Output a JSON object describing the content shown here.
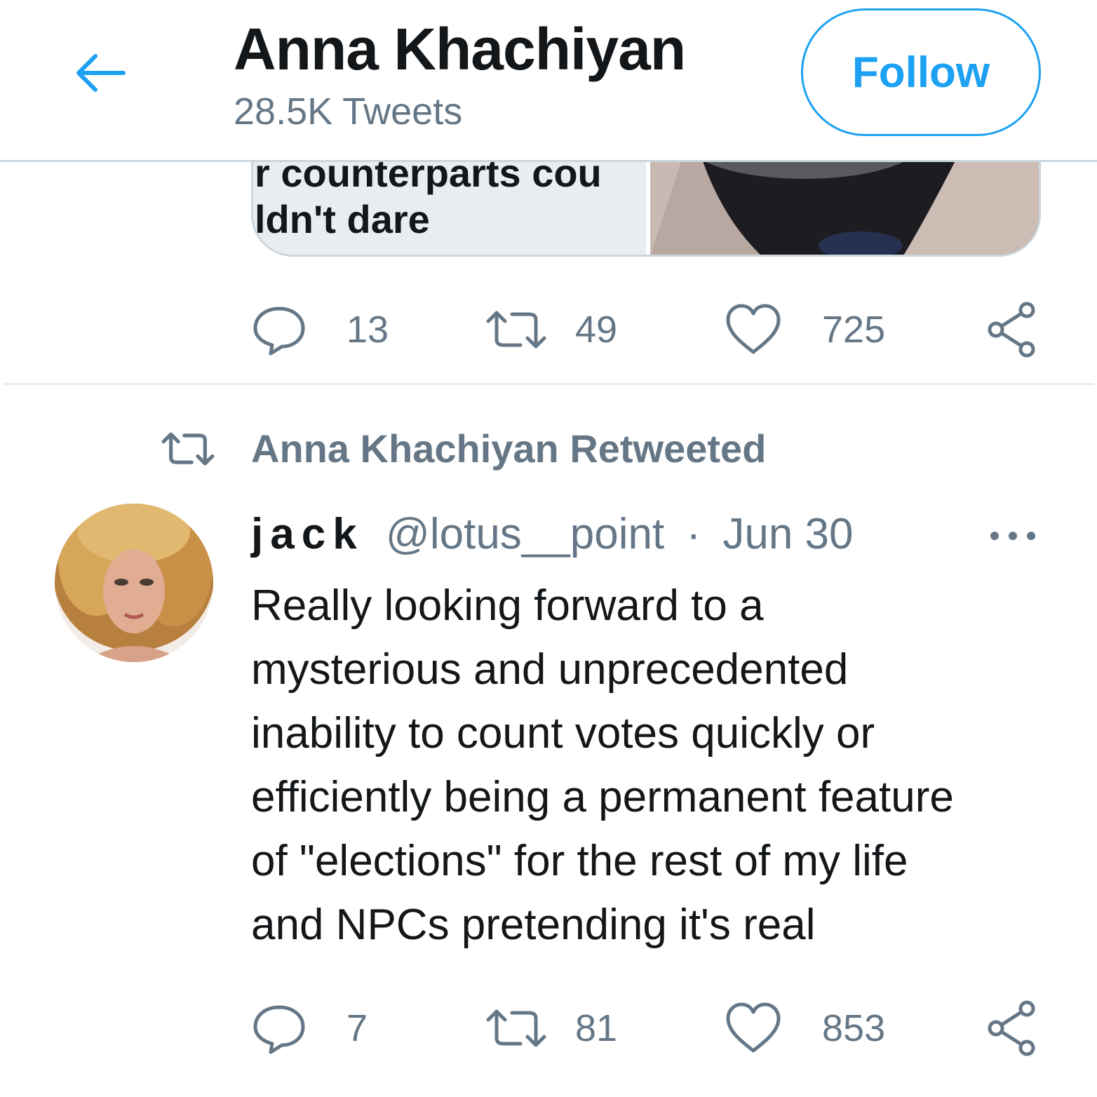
{
  "header": {
    "back_icon": "arrow-left-icon",
    "name": "Anna Khachiyan",
    "tweet_count": "28.5K Tweets",
    "follow_label": "Follow",
    "accent_color": "#1da1f2"
  },
  "previous_tweet": {
    "card_text_line1": "r counterparts cou",
    "card_text_line2": "ldn't dare",
    "actions": {
      "reply_count": "13",
      "retweet_count": "49",
      "like_count": "725"
    }
  },
  "retweet_context": {
    "icon": "retweet-icon",
    "label": "Anna Khachiyan Retweeted"
  },
  "tweet": {
    "display_name": "jack",
    "handle": "@lotus__point",
    "separator": "·",
    "date": "Jun 30",
    "body_lines": [
      "Really looking forward to a",
      "mysterious and unprecedented",
      "inability to count votes quickly or",
      "efficiently being a permanent feature",
      "of \"elections\" for the rest of my life",
      "and NPCs pretending it's real"
    ],
    "actions": {
      "reply_count": "7",
      "retweet_count": "81",
      "like_count": "853"
    }
  },
  "colors": {
    "primary_text": "#14171a",
    "secondary_text": "#657786",
    "border": "#ccd6dd"
  }
}
